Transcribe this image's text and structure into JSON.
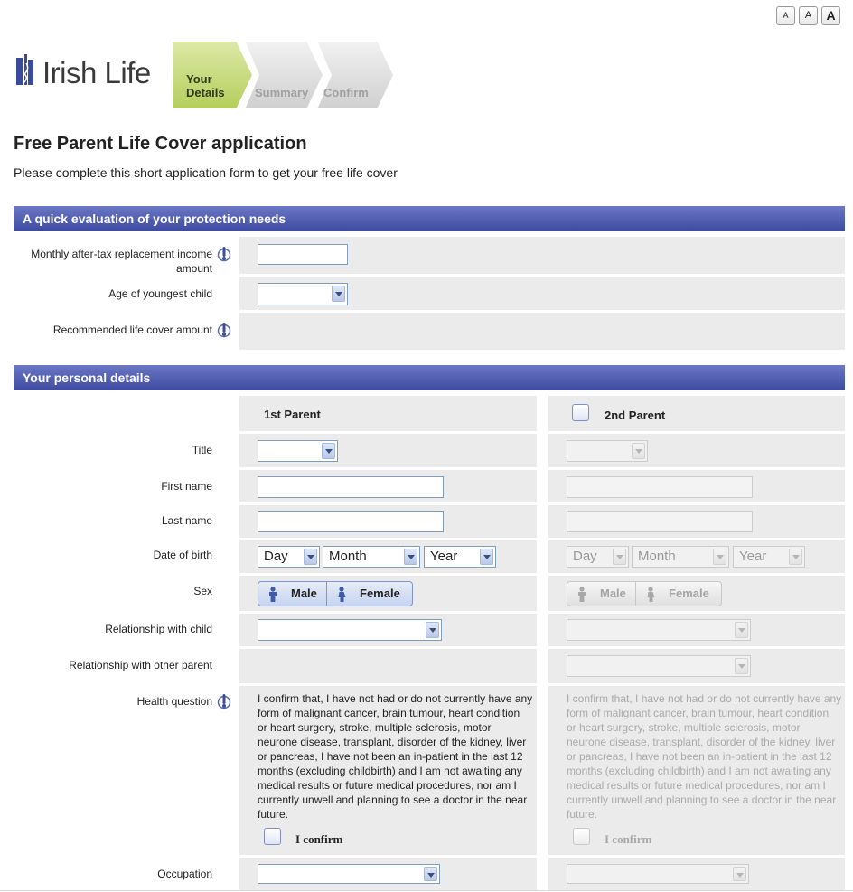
{
  "font_size_buttons": [
    "A",
    "A",
    "A"
  ],
  "brand": {
    "name": "Irish Life"
  },
  "steps": [
    {
      "label_line1": "Your",
      "label_line2": "Details",
      "active": true
    },
    {
      "label_line1": "Summary",
      "label_line2": "",
      "active": false
    },
    {
      "label_line1": "Confirm",
      "label_line2": "",
      "active": false
    }
  ],
  "page": {
    "title": "Free Parent Life Cover application",
    "intro": "Please complete this short application form to get your free life cover"
  },
  "evaluation": {
    "heading": "A quick evaluation of your protection needs",
    "income_label_line1": "Monthly after-tax replacement income",
    "income_label_line2": "amount",
    "income_value": "",
    "age_label": "Age of youngest child",
    "age_value": "",
    "recommended_label": "Recommended life cover amount",
    "recommended_value": ""
  },
  "personal": {
    "heading": "Your personal details",
    "parent1_heading": "1st Parent",
    "parent2_heading": "2nd Parent",
    "labels": {
      "title": "Title",
      "first_name": "First name",
      "last_name": "Last name",
      "dob": "Date of birth",
      "sex": "Sex",
      "rel_child": "Relationship with child",
      "rel_parent": "Relationship with other parent",
      "health": "Health question",
      "occupation": "Occupation"
    },
    "dob_placeholders": {
      "day": "Day",
      "month": "Month",
      "year": "Year"
    },
    "sex_options": {
      "male": "Male",
      "female": "Female"
    },
    "health_text": "I confirm that, I have not had or do not currently have any form of malignant cancer, brain tumour, heart condition or heart surgery, stroke, multiple sclerosis, motor neurone disease, transplant, disorder of the kidney, liver or pancreas, I have not been an in-patient in the last 12 months (excluding childbirth) and I am not awaiting any medical results or future medical procedures, nor am I currently unwell and planning to see a doctor in the near future.",
    "health_lines": [
      "I confirm that, I have not had or do not currently have any",
      "form of malignant cancer, brain tumour, heart condition",
      "or heart surgery, stroke, multiple sclerosis, motor",
      "neurone disease, transplant, disorder of the kidney, liver",
      "or pancreas, I have not been an in-patient in the last 12",
      "months (excluding childbirth) and I am not awaiting any",
      "medical results or future medical procedures, nor am I",
      "currently unwell and planning to see a doctor in the near",
      "future."
    ],
    "confirm_label": "I confirm"
  },
  "colors": {
    "section_bar": "#4a57ad",
    "active_step": "#c6dc7a",
    "row_background": "#ebebeb"
  }
}
